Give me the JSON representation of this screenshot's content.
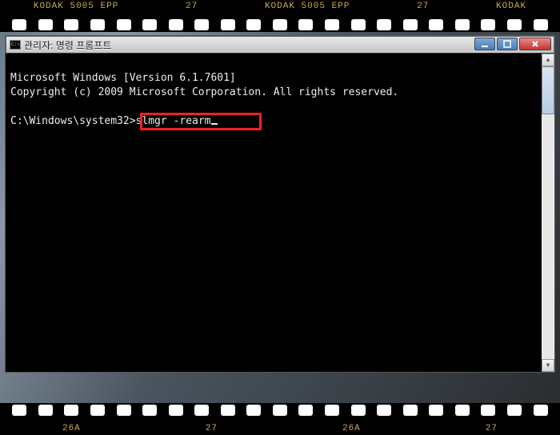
{
  "film": {
    "top_labels": [
      "KODAK 5005 EPP",
      "27",
      "KODAK 5005 EPP",
      "27",
      "KODAK"
    ],
    "bottom_labels": [
      "26A",
      "27",
      "26A",
      "27"
    ]
  },
  "window": {
    "title": "관리자: 명령 프롬프트"
  },
  "console": {
    "line1": "Microsoft Windows [Version 6.1.7601]",
    "line2": "Copyright (c) 2009 Microsoft Corporation. All rights reserved.",
    "blank": "",
    "prompt_path": "C:\\Windows\\system32>",
    "command": "slmgr -rearm"
  },
  "icons": {
    "min": "minimize-icon",
    "max": "maximize-icon",
    "close": "close-icon",
    "up": "▲",
    "down": "▼"
  }
}
